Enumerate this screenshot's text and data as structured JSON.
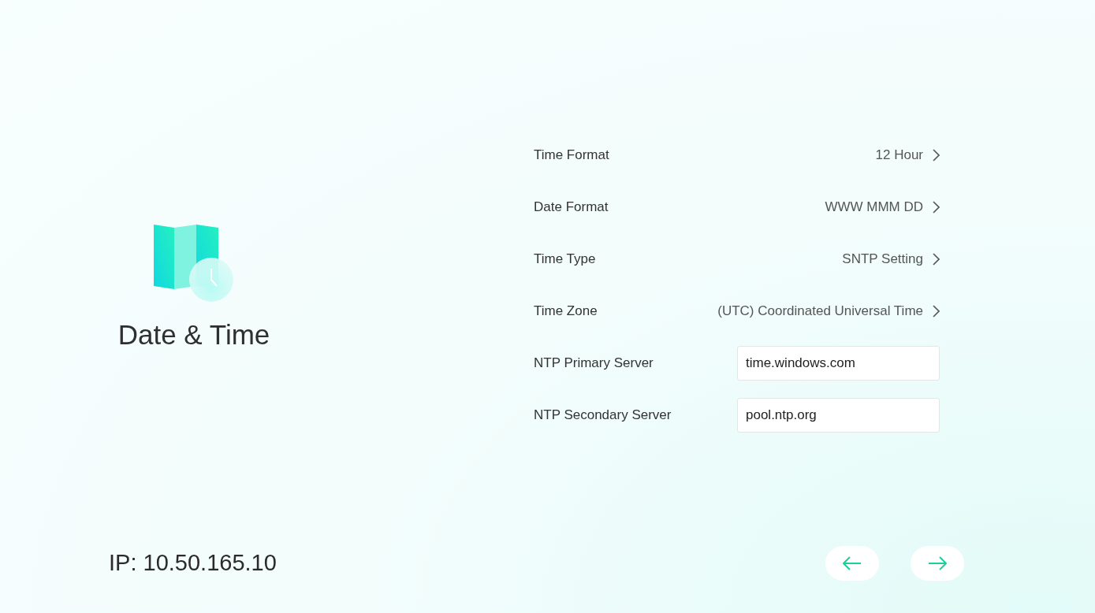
{
  "page": {
    "title": "Date & Time"
  },
  "settings": [
    {
      "kind": "select",
      "label": "Time Format",
      "value": "12 Hour"
    },
    {
      "kind": "select",
      "label": "Date Format",
      "value": "WWW MMM DD"
    },
    {
      "kind": "select",
      "label": "Time Type",
      "value": "SNTP Setting"
    },
    {
      "kind": "select",
      "label": "Time Zone",
      "value": "(UTC) Coordinated Universal Time"
    },
    {
      "kind": "input",
      "label": "NTP Primary Server",
      "value": "time.windows.com"
    },
    {
      "kind": "input",
      "label": "NTP Secondary Server",
      "value": "pool.ntp.org"
    }
  ],
  "footer": {
    "ip": "IP: 10.50.165.10"
  }
}
